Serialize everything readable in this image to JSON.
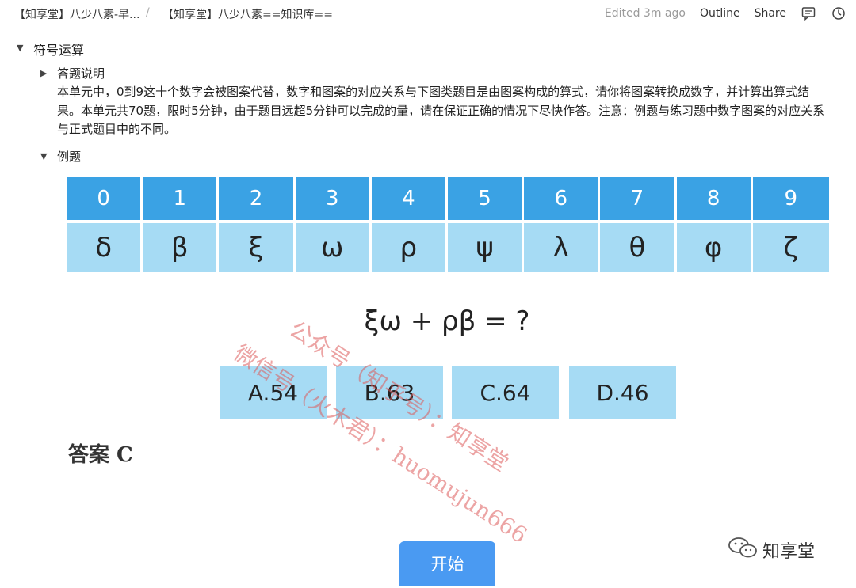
{
  "topbar": {
    "breadcrumb": [
      "【知享堂】八少八素-早...",
      "【知享堂】八少八素==知识库=="
    ],
    "separator": "/",
    "edited": "Edited 3m ago",
    "outline": "Outline",
    "share": "Share",
    "icons": [
      "comment-icon",
      "history-icon"
    ]
  },
  "section": {
    "title": "符号运算",
    "instructions_label": "答题说明",
    "description": "本单元中，0到9这十个数字会被图案代替，数字和图案的对应关系与下图类题目是由图案构成的算式，请你将图案转换成数字，并计算出算式结果。本单元共70题，限时5分钟，由于题目远超5分钟可以完成的量，请在保证正确的情况下尽快作答。注意：例题与练习题中数字图案的对应关系与正式题目中的不同。",
    "example_label": "例题"
  },
  "mapping": {
    "numbers": [
      "0",
      "1",
      "2",
      "3",
      "4",
      "5",
      "6",
      "7",
      "8",
      "9"
    ],
    "symbols": [
      "δ",
      "β",
      "ξ",
      "ω",
      "ρ",
      "ψ",
      "λ",
      "θ",
      "φ",
      "ζ"
    ]
  },
  "question": "ξω + ρβ = ?",
  "options": [
    "A.54",
    "B.63",
    "C.64",
    "D.46"
  ],
  "answer": "答案 C",
  "start_button": "开始",
  "watermark": {
    "line1": "公众号（知乎号）：知享堂",
    "line2": "微信号（火木君）：huomujun666"
  },
  "brand": "知享堂",
  "colors": {
    "header_blue": "#3aa2e4",
    "cell_light_blue": "#a6dbf4",
    "button_blue": "#4a9af2",
    "watermark_red": "#dc5a5a"
  }
}
